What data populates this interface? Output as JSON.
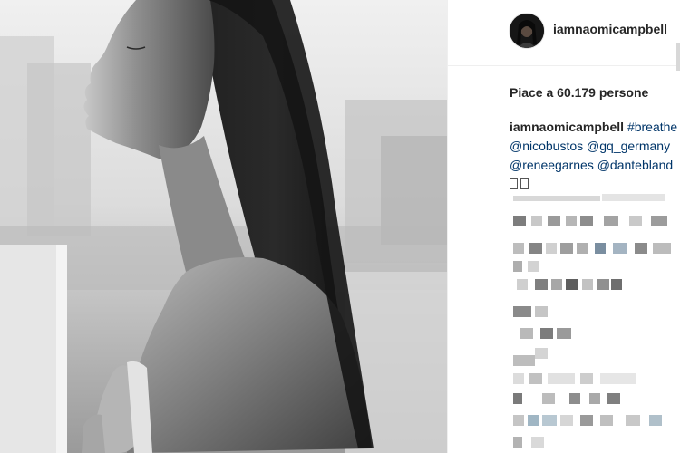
{
  "post": {
    "username": "iamnaomicampbell",
    "likes_text": "Piace a 60.179 persone",
    "caption": {
      "user": "iamnaomicampbell",
      "hashtag": "#breathe",
      "line2": "@nicobustos @gq_germany",
      "line3": "@reneegarnes @dantebland"
    }
  },
  "comments_note": "pixelated",
  "icons": {
    "avatar": "profile-avatar",
    "photo": "black-and-white-portrait"
  }
}
